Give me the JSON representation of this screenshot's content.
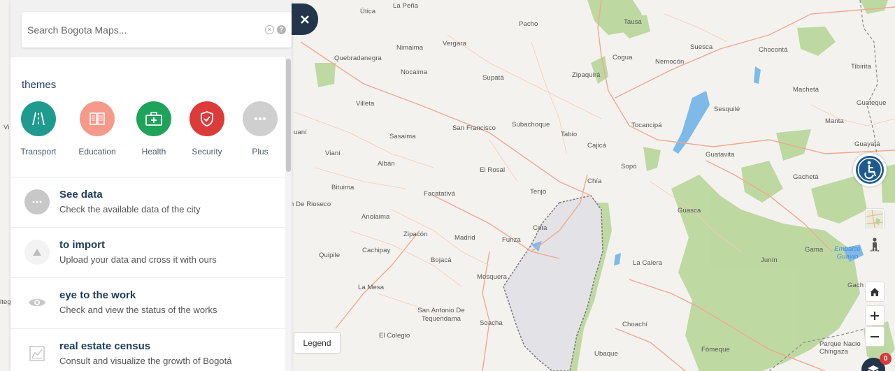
{
  "search": {
    "placeholder": "Search Bogota Maps..."
  },
  "themes": {
    "title": "themes",
    "items": [
      {
        "label": "Transport",
        "color": "#1e9b8e",
        "icon": "road-icon"
      },
      {
        "label": "Education",
        "color": "#f59a8a",
        "icon": "book-icon"
      },
      {
        "label": "Health",
        "color": "#1ea35a",
        "icon": "first-aid-kit-icon"
      },
      {
        "label": "Security",
        "color": "#dd3a3a",
        "icon": "shield-icon"
      },
      {
        "label": "Plus",
        "color": "#cfcfcf",
        "icon": "more-icon"
      }
    ]
  },
  "menu": [
    {
      "title": "See data",
      "desc": "Check the available data of the city",
      "icon": "more-icon"
    },
    {
      "title": "to import",
      "desc": "Upload your data and cross it with ours",
      "icon": "upload-icon"
    },
    {
      "title": "eye to the work",
      "desc": "Check and view the status of the works",
      "icon": "eye-icon"
    },
    {
      "title": "real estate census",
      "desc": "Consult and visualize the growth of Bogotá",
      "icon": "chart-icon"
    }
  ],
  "legend": {
    "label": "Legend"
  },
  "layers": {
    "badge": "0"
  },
  "map": {
    "places": [
      "La Peña",
      "Útica",
      "Pacho",
      "Tausa",
      "Vergara",
      "Nimaima",
      "Quebradanegra",
      "Cogua",
      "Nemocón",
      "Suesca",
      "Chocontá",
      "Tibirita",
      "Nocaima",
      "Supatá",
      "Zipaquirá",
      "Machetá",
      "Villeta",
      "Guateque",
      "San Francisco",
      "Subachoque",
      "Sesquilé",
      "Manta",
      "Tabio",
      "Tocancipá",
      "uaní",
      "Sasaima",
      "Guayatá",
      "Cajicá",
      "Guatavita",
      "Vianí",
      "Albán",
      "El Rosal",
      "Sopó",
      "Gachetá",
      "Chía",
      "Bituima",
      "Facatativá",
      "Tenjo",
      "Guasca",
      "n De Rioseco",
      "Anolaima",
      "Cota",
      "Zipacón",
      "Madrid",
      "Funza",
      "Gama",
      "Embalse Guavio",
      "Quipile",
      "Cachipay",
      "La Calera",
      "Junín",
      "Bojacá",
      "Mosquera",
      "La Mesa",
      "Gach",
      "San Antonio De Tequendama",
      "Choachí",
      "El Colegio",
      "Soacha",
      "Ubaque",
      "Fómeque",
      "Parque Nacio Chingaza",
      "ltega",
      "Vi"
    ],
    "water_places": [
      "Embalse Guavio"
    ]
  }
}
